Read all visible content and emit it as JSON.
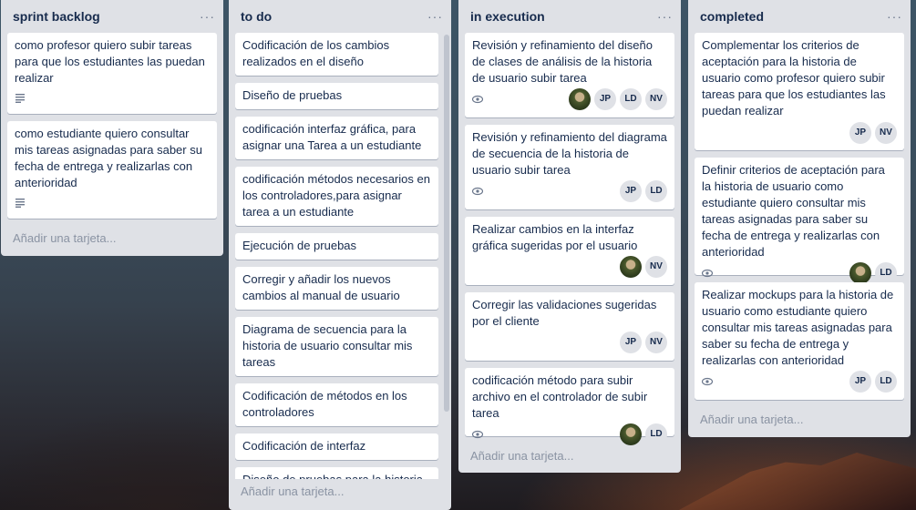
{
  "lists": [
    {
      "title": "sprint backlog",
      "add_label": "Añadir una tarjeta...",
      "cards": [
        {
          "text": "como profesor quiero subir tareas para que los estudiantes las puedan realizar"
        },
        {
          "text": "como estudiante quiero consultar mis tareas asignadas para saber su fecha de entrega y realizarlas con anterioridad"
        }
      ]
    },
    {
      "title": "to do",
      "add_label": "Añadir una tarjeta...",
      "cards": [
        {
          "text": "Codificación de los cambios realizados en el diseño"
        },
        {
          "text": "Diseño de pruebas"
        },
        {
          "text": "codificación interfaz gráfica, para asignar una Tarea a un estudiante"
        },
        {
          "text": "codificación métodos necesarios en los controladores,para asignar tarea a un estudiante"
        },
        {
          "text": "Ejecución de pruebas"
        },
        {
          "text": "Corregir y añadir los nuevos cambios al manual de usuario"
        },
        {
          "text": "Diagrama de secuencia para la historia de usuario consultar mis tareas"
        },
        {
          "text": "Codificación de métodos en los controladores"
        },
        {
          "text": "Codificación de interfaz"
        },
        {
          "text": "Diseño de pruebas para la historia de"
        }
      ]
    },
    {
      "title": "in execution",
      "add_label": "Añadir una tarjeta...",
      "cards": [
        {
          "text": "Revisión y refinamiento del diseño de clases de análisis de la historia de usuario subir tarea",
          "members": [
            "JP",
            "LD",
            "NV"
          ]
        },
        {
          "text": "Revisión y refinamiento del diagrama de secuencia de la historia de usuario subir tarea",
          "members": [
            "JP",
            "LD"
          ]
        },
        {
          "text": "Realizar cambios en la interfaz gráfica sugeridas por el usuario",
          "members": [
            "NV"
          ]
        },
        {
          "text": "Corregir las validaciones sugeridas por el cliente",
          "members": [
            "JP",
            "NV"
          ]
        },
        {
          "text": "codificación método para subir archivo en el controlador de subir tarea",
          "members": [
            "LD"
          ]
        }
      ]
    },
    {
      "title": "completed",
      "add_label": "Añadir una tarjeta...",
      "cards": [
        {
          "text": "Complementar los criterios de aceptación para la historia de usuario como profesor quiero subir tareas para que los estudiantes las puedan realizar",
          "members": [
            "JP",
            "NV"
          ]
        },
        {
          "text": "Definir criterios de aceptación para la historia de usuario como estudiante quiero consultar mis tareas asignadas para saber su fecha de entrega y realizarlas con anterioridad",
          "members": [
            "LD"
          ]
        },
        {
          "text": "Realizar mockups para la historia de usuario como estudiante quiero consultar mis tareas asignadas para saber su fecha de entrega y realizarlas con anterioridad",
          "members": [
            "JP",
            "LD"
          ]
        }
      ]
    }
  ],
  "menu_glyph": "···"
}
